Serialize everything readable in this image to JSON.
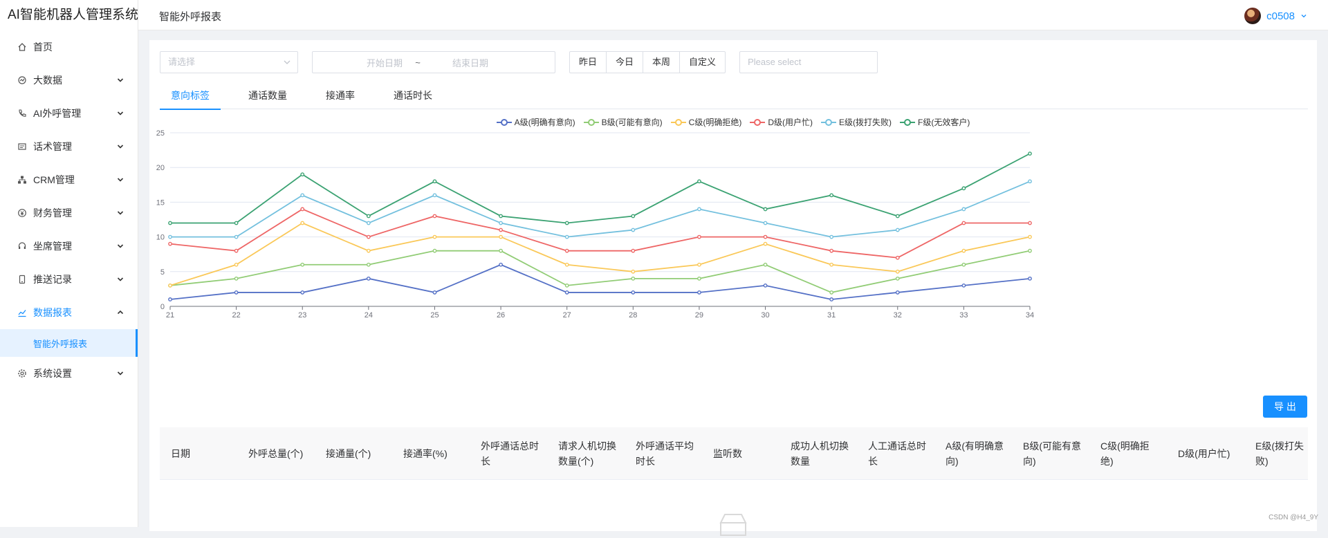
{
  "app": {
    "title": "AI智能机器人管理系统"
  },
  "sidebar": {
    "items": [
      {
        "label": "首页",
        "icon": "home-icon",
        "expandable": false
      },
      {
        "label": "大数据",
        "icon": "bigdata-icon",
        "expandable": true
      },
      {
        "label": "AI外呼管理",
        "icon": "phone-icon",
        "expandable": true
      },
      {
        "label": "话术管理",
        "icon": "script-icon",
        "expandable": true
      },
      {
        "label": "CRM管理",
        "icon": "org-chart-icon",
        "expandable": true
      },
      {
        "label": "财务管理",
        "icon": "finance-icon",
        "expandable": true
      },
      {
        "label": "坐席管理",
        "icon": "headset-icon",
        "expandable": true
      },
      {
        "label": "推送记录",
        "icon": "mobile-icon",
        "expandable": true
      },
      {
        "label": "数据报表",
        "icon": "line-chart-icon",
        "expandable": true,
        "expanded": true
      },
      {
        "label": "系统设置",
        "icon": "gear-icon",
        "expandable": true
      }
    ],
    "active_sub": "智能外呼报表"
  },
  "header": {
    "page_title": "智能外呼报表",
    "username": "c0508"
  },
  "filters": {
    "select_placeholder": "请选择",
    "start_date_placeholder": "开始日期",
    "range_separator": "~",
    "end_date_placeholder": "结束日期",
    "quick_buttons": [
      "昨日",
      "今日",
      "本周",
      "自定义"
    ],
    "select2_placeholder": "Please select"
  },
  "tabs": [
    {
      "label": "意向标签",
      "active": true
    },
    {
      "label": "通话数量",
      "active": false
    },
    {
      "label": "接通率",
      "active": false
    },
    {
      "label": "通话时长",
      "active": false
    }
  ],
  "chart_data": {
    "type": "line",
    "x": [
      21,
      22,
      23,
      24,
      25,
      26,
      27,
      28,
      29,
      30,
      31,
      32,
      33,
      34
    ],
    "ylim": [
      0,
      25
    ],
    "yticks": [
      0,
      5,
      10,
      15,
      20,
      25
    ],
    "grid": true,
    "legend_position": "top-center",
    "series": [
      {
        "name": "A级(明确有意向)",
        "color": "#5470c6",
        "values": [
          1,
          2,
          2,
          4,
          2,
          6,
          2,
          2,
          2,
          3,
          1,
          2,
          3,
          4
        ]
      },
      {
        "name": "B级(可能有意向)",
        "color": "#91cc75",
        "values": [
          3,
          4,
          6,
          6,
          8,
          8,
          3,
          4,
          4,
          6,
          2,
          4,
          6,
          8
        ]
      },
      {
        "name": "C级(明确拒绝)",
        "color": "#fac858",
        "values": [
          3,
          6,
          12,
          8,
          10,
          10,
          6,
          5,
          6,
          9,
          6,
          5,
          8,
          10
        ]
      },
      {
        "name": "D级(用户忙)",
        "color": "#ee6666",
        "values": [
          9,
          8,
          14,
          10,
          13,
          11,
          8,
          8,
          10,
          10,
          8,
          7,
          12,
          12
        ]
      },
      {
        "name": "E级(拨打失败)",
        "color": "#73c0de",
        "values": [
          10,
          10,
          16,
          12,
          16,
          12,
          10,
          11,
          14,
          12,
          10,
          11,
          14,
          18
        ]
      },
      {
        "name": "F级(无效客户)",
        "color": "#3ba272",
        "values": [
          12,
          12,
          19,
          13,
          18,
          13,
          12,
          13,
          18,
          14,
          16,
          13,
          17,
          22
        ]
      }
    ]
  },
  "export_label": "导 出",
  "table": {
    "headers": [
      "日期",
      "外呼总量(个)",
      "接通量(个)",
      "接通率(%)",
      "外呼通话总时长",
      "请求人机切换数量(个)",
      "外呼通话平均时长",
      "监听数",
      "成功人机切换数量",
      "人工通话总时长",
      "A级(有明确意向)",
      "B级(可能有意向)",
      "C级(明确拒绝)",
      "D级(用户忙)",
      "E级(拨打失败)"
    ]
  },
  "watermark": "CSDN @H4_9Y",
  "colors": {
    "accent": "#1890ff"
  }
}
